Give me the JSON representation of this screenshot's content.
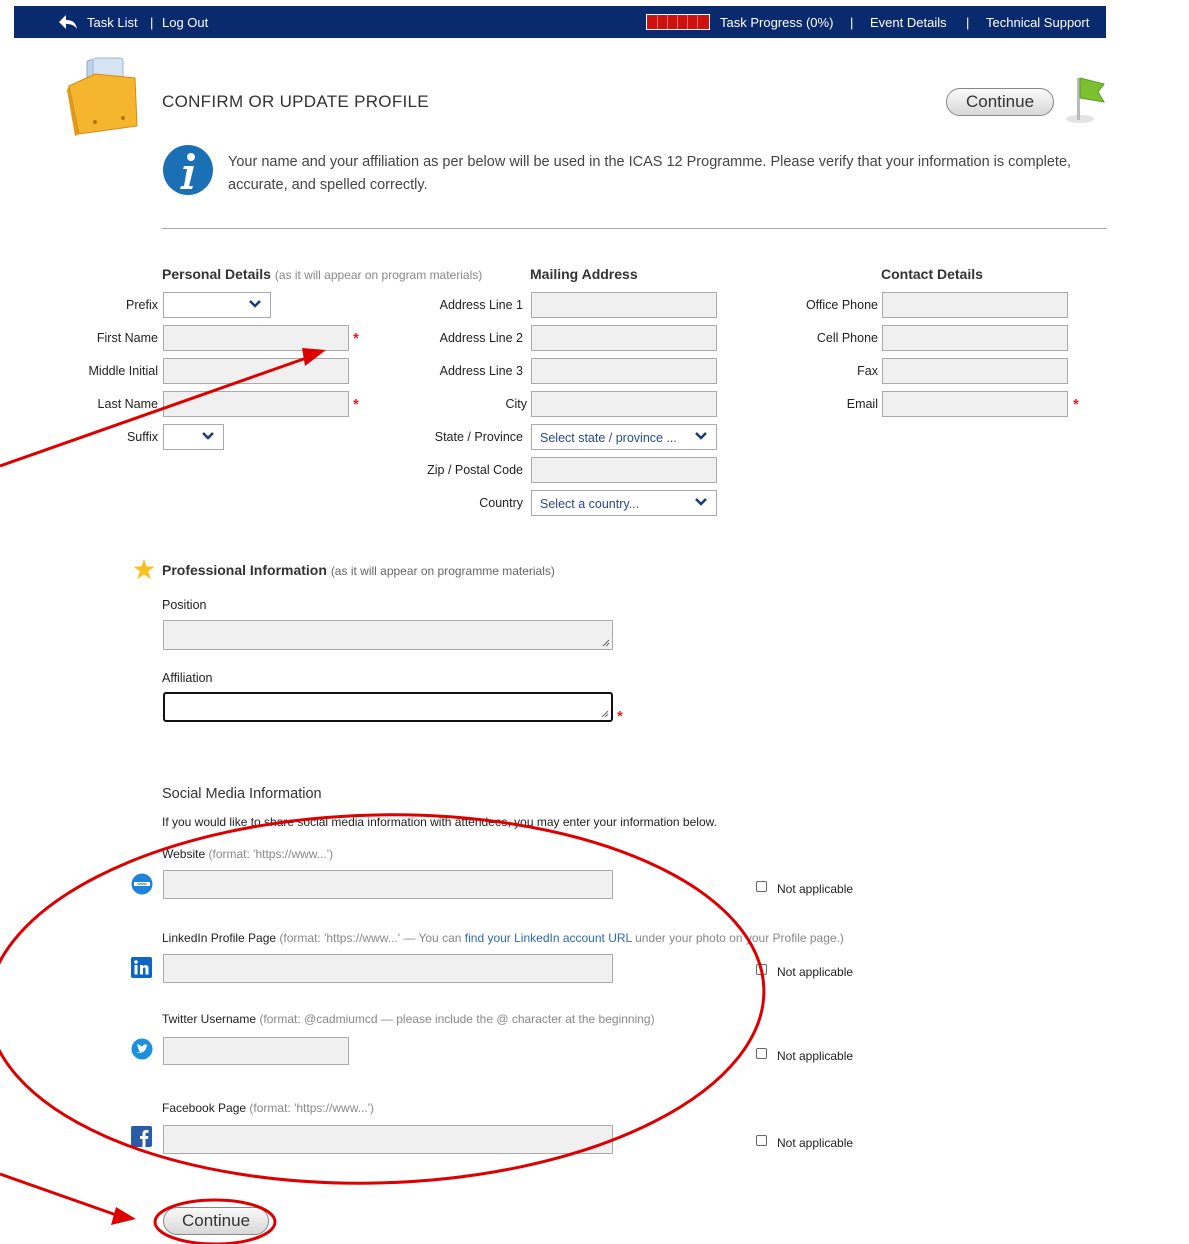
{
  "topbar": {
    "task_list": "Task List",
    "divider": "|",
    "log_out": "Log Out",
    "task_progress": "Task Progress (0%)",
    "progress_fraction": 0,
    "event_details": "Event Details",
    "technical_support": "Technical Support"
  },
  "page": {
    "title": "CONFIRM OR UPDATE PROFILE",
    "continue_top": "Continue",
    "info_text": "Your name and your affiliation as per below will be used in the ICAS 12 Programme. Please verify that your information is complete, accurate, and spelled correctly.",
    "continue_bottom": "Continue"
  },
  "personal": {
    "heading": "Personal Details",
    "hint": "(as it will appear on program materials)",
    "prefix": "Prefix",
    "first_name": "First Name",
    "middle_initial": "Middle Initial",
    "last_name": "Last Name",
    "suffix": "Suffix"
  },
  "mailing": {
    "heading": "Mailing Address",
    "line1": "Address Line 1",
    "line2": "Address Line 2",
    "line3": "Address Line 3",
    "city": "City",
    "state": "State / Province",
    "state_placeholder": "Select state / province ...",
    "zip": "Zip / Postal Code",
    "country": "Country",
    "country_placeholder": "Select a country..."
  },
  "contact": {
    "heading": "Contact Details",
    "office_phone": "Office Phone",
    "cell_phone": "Cell Phone",
    "fax": "Fax",
    "email": "Email"
  },
  "professional": {
    "heading": "Professional Information",
    "hint": "(as it will appear on programme materials)",
    "position": "Position",
    "affiliation": "Affiliation"
  },
  "social": {
    "heading": "Social Media Information",
    "intro": "If you would like to share social media information with attendees, you may enter your information below.",
    "website_label": "Website",
    "website_hint": "(format: 'https://www...')",
    "linkedin_label": "LinkedIn Profile Page",
    "linkedin_hint_a": "(format: 'https://www...' — You can",
    "linkedin_link": "find your LinkedIn account URL",
    "linkedin_hint_b": "under your photo on your Profile page.)",
    "twitter_label": "Twitter Username",
    "twitter_hint": "(format: @cadmiumcd — please include the @ character at the beginning)",
    "facebook_label": "Facebook Page",
    "facebook_hint": "(format: 'https://www...')",
    "not_applicable": "Not applicable"
  },
  "colors": {
    "topbar": "#0a2a6e",
    "required": "#dd2222",
    "annotation": "#dd0000",
    "link": "#2a6ab0"
  }
}
